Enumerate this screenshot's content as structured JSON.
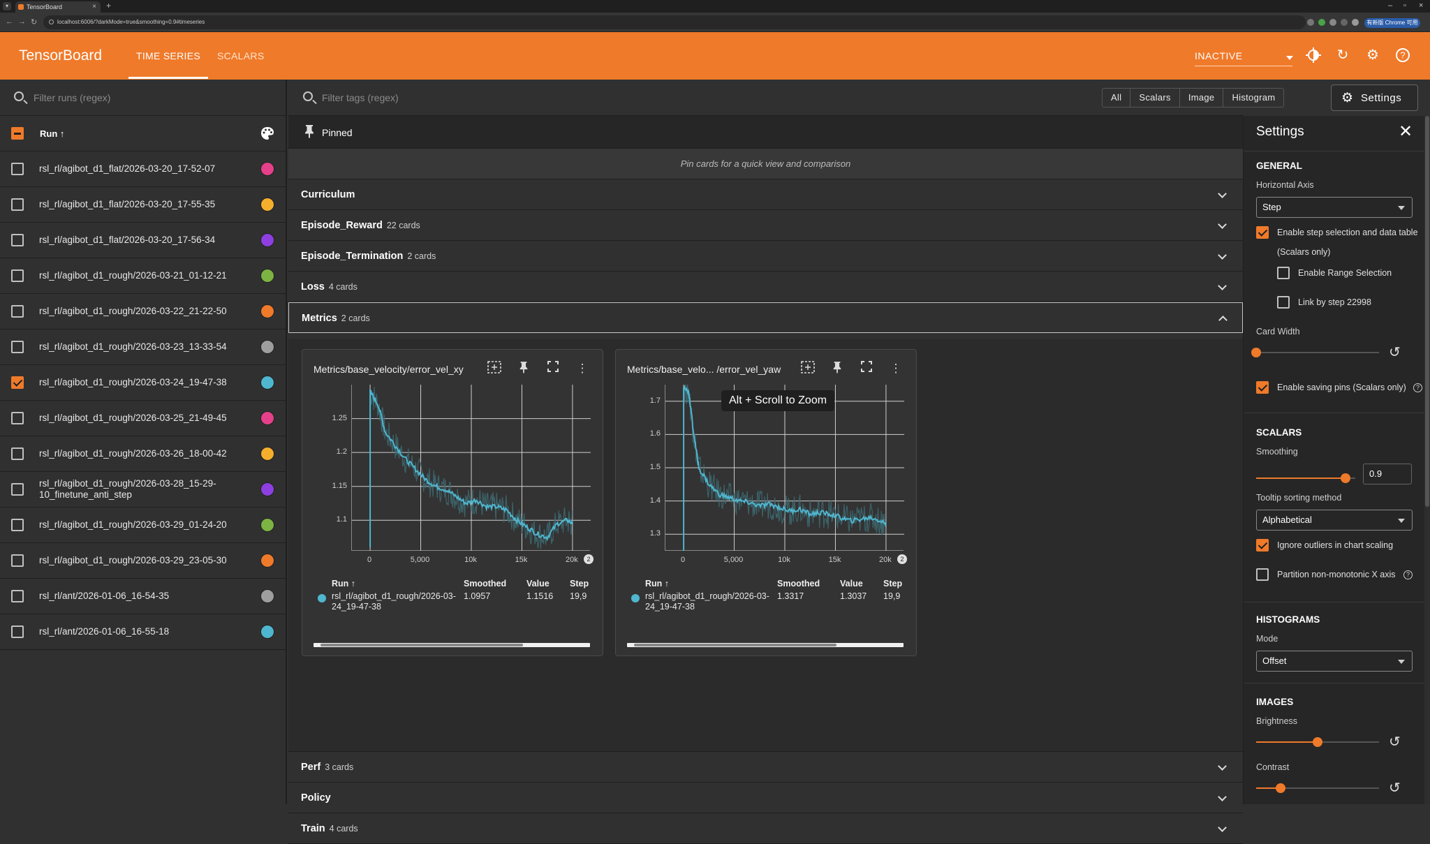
{
  "browser": {
    "tab_title": "TensorBoard",
    "url": "localhost:6006/?darkMode=true&smoothing=0.9#timeseries",
    "ext_label": "有新版 Chrome 可用"
  },
  "header": {
    "brand": "TensorBoard",
    "tabs": [
      {
        "label": "TIME SERIES",
        "active": true
      },
      {
        "label": "SCALARS",
        "active": false
      }
    ],
    "status": "INACTIVE"
  },
  "runs": {
    "filter_placeholder": "Filter runs (regex)",
    "column_label": "Run ↑",
    "items": [
      {
        "name": "rsl_rl/agibot_d1_flat/2026-03-20_17-52-07",
        "checked": false,
        "color": "#e5408a"
      },
      {
        "name": "rsl_rl/agibot_d1_flat/2026-03-20_17-55-35",
        "checked": false,
        "color": "#f6ae2d"
      },
      {
        "name": "rsl_rl/agibot_d1_flat/2026-03-20_17-56-34",
        "checked": false,
        "color": "#8e3fe0"
      },
      {
        "name": "rsl_rl/agibot_d1_rough/2026-03-21_01-12-21",
        "checked": false,
        "color": "#7cb342"
      },
      {
        "name": "rsl_rl/agibot_d1_rough/2026-03-22_21-22-50",
        "checked": false,
        "color": "#ef7a2a"
      },
      {
        "name": "rsl_rl/agibot_d1_rough/2026-03-23_13-33-54",
        "checked": false,
        "color": "#9e9e9e"
      },
      {
        "name": "rsl_rl/agibot_d1_rough/2026-03-24_19-47-38",
        "checked": true,
        "color": "#4fb6cf"
      },
      {
        "name": "rsl_rl/agibot_d1_rough/2026-03-25_21-49-45",
        "checked": false,
        "color": "#e5408a"
      },
      {
        "name": "rsl_rl/agibot_d1_rough/2026-03-26_18-00-42",
        "checked": false,
        "color": "#f6ae2d"
      },
      {
        "name": "rsl_rl/agibot_d1_rough/2026-03-28_15-29-10_finetune_anti_step",
        "checked": false,
        "color": "#8e3fe0"
      },
      {
        "name": "rsl_rl/agibot_d1_rough/2026-03-29_01-24-20",
        "checked": false,
        "color": "#7cb342"
      },
      {
        "name": "rsl_rl/agibot_d1_rough/2026-03-29_23-05-30",
        "checked": false,
        "color": "#ef7a2a"
      },
      {
        "name": "rsl_rl/ant/2026-01-06_16-54-35",
        "checked": false,
        "color": "#9e9e9e"
      },
      {
        "name": "rsl_rl/ant/2026-01-06_16-55-18",
        "checked": false,
        "color": "#4fb6cf"
      }
    ]
  },
  "main": {
    "filter_placeholder": "Filter tags (regex)",
    "type_filters": [
      "All",
      "Scalars",
      "Image",
      "Histogram"
    ],
    "settings_button": "Settings",
    "pinned_label": "Pinned",
    "pinned_hint": "Pin cards for a quick view and comparison",
    "groups_top": [
      {
        "name": "Curriculum",
        "count": ""
      },
      {
        "name": "Episode_Reward",
        "count": "22 cards"
      },
      {
        "name": "Episode_Termination",
        "count": "2 cards"
      },
      {
        "name": "Loss",
        "count": "4 cards"
      },
      {
        "name": "Metrics",
        "count": "2 cards"
      }
    ],
    "groups_bottom": [
      {
        "name": "Perf",
        "count": "3 cards"
      },
      {
        "name": "Policy",
        "count": ""
      },
      {
        "name": "Train",
        "count": "4 cards"
      }
    ],
    "tooltip": "Alt + Scroll to Zoom"
  },
  "cards": [
    {
      "title": "Metrics/base_velocity/error_vel_xy",
      "table_headers": {
        "run": "Run ↑",
        "smoothed": "Smoothed",
        "value": "Value",
        "step": "Step"
      },
      "row": {
        "run": "rsl_rl/agibot_d1_rough/2026-03-24_19-47-38",
        "smoothed": "1.0957",
        "value": "1.1516",
        "step": "19,9"
      },
      "badge": "2"
    },
    {
      "title": "Metrics/base_velo... /error_vel_yaw",
      "table_headers": {
        "run": "Run ↑",
        "smoothed": "Smoothed",
        "value": "Value",
        "step": "Step"
      },
      "row": {
        "run": "rsl_rl/agibot_d1_rough/2026-03-24_19-47-38",
        "smoothed": "1.3317",
        "value": "1.3037",
        "step": "19,9"
      },
      "badge": "2"
    }
  ],
  "chart_data": [
    {
      "type": "line",
      "title": "Metrics/base_velocity/error_vel_xy",
      "x_ticks": [
        "0",
        "5,000",
        "10k",
        "15k",
        "20k"
      ],
      "y_ticks": [
        "1.1",
        "1.15",
        "1.2",
        "1.25"
      ],
      "xlim": [
        -1800,
        21800
      ],
      "ylim": [
        1.055,
        1.3
      ],
      "series": [
        {
          "color": "#4fb6cf",
          "x": [
            0,
            0,
            800,
            1500,
            2500,
            3500,
            4500,
            5500,
            6500,
            7500,
            8500,
            9500,
            10500,
            11500,
            12500,
            13500,
            14500,
            15500,
            16500,
            17500,
            18500,
            19500,
            20000
          ],
          "y": [
            1.06,
            1.29,
            1.27,
            1.23,
            1.21,
            1.19,
            1.175,
            1.16,
            1.15,
            1.145,
            1.135,
            1.125,
            1.13,
            1.12,
            1.12,
            1.115,
            1.1,
            1.09,
            1.08,
            1.075,
            1.095,
            1.1,
            1.0957
          ]
        }
      ]
    },
    {
      "type": "line",
      "title": "Metrics/base_velo... /error_vel_yaw",
      "x_ticks": [
        "0",
        "5,000",
        "10k",
        "15k",
        "20k"
      ],
      "y_ticks": [
        "1.3",
        "1.4",
        "1.5",
        "1.6",
        "1.7"
      ],
      "xlim": [
        -1800,
        21800
      ],
      "ylim": [
        1.25,
        1.75
      ],
      "series": [
        {
          "color": "#4fb6cf",
          "x": [
            0,
            0,
            500,
            1000,
            1500,
            2500,
            3500,
            4500,
            5500,
            6500,
            7500,
            8500,
            9500,
            10500,
            11500,
            12500,
            13500,
            14500,
            15500,
            16500,
            17500,
            18500,
            19500,
            20000
          ],
          "y": [
            1.25,
            1.74,
            1.73,
            1.6,
            1.5,
            1.45,
            1.42,
            1.41,
            1.4,
            1.395,
            1.385,
            1.39,
            1.38,
            1.37,
            1.375,
            1.36,
            1.365,
            1.36,
            1.35,
            1.34,
            1.345,
            1.35,
            1.34,
            1.3317
          ]
        }
      ]
    }
  ],
  "settings": {
    "title": "Settings",
    "general": "GENERAL",
    "horizontal_axis_label": "Horizontal Axis",
    "horizontal_axis_value": "Step",
    "enable_step_selection": "Enable step selection and data table",
    "scalars_only": "(Scalars only)",
    "enable_range_selection": "Enable Range Selection",
    "link_by_step": "Link by step 22998",
    "card_width": "Card Width",
    "enable_saving_pins": "Enable saving pins (Scalars only)",
    "scalars": "SCALARS",
    "smoothing_label": "Smoothing",
    "smoothing_value": "0.9",
    "smoothing": 0.9,
    "tooltip_sort_label": "Tooltip sorting method",
    "tooltip_sort_value": "Alphabetical",
    "ignore_outliers": "Ignore outliers in chart scaling",
    "partition_non_monotonic": "Partition non-monotonic X axis",
    "histograms": "HISTOGRAMS",
    "mode_label": "Mode",
    "mode_value": "Offset",
    "images": "IMAGES",
    "brightness_label": "Brightness",
    "brightness_level": 0.5,
    "contrast_label": "Contrast",
    "contrast_level": 0.2,
    "card_width_level": 0.0
  },
  "colors": {
    "accent": "#ef7a2a",
    "run_selected": "#4fb6cf"
  }
}
